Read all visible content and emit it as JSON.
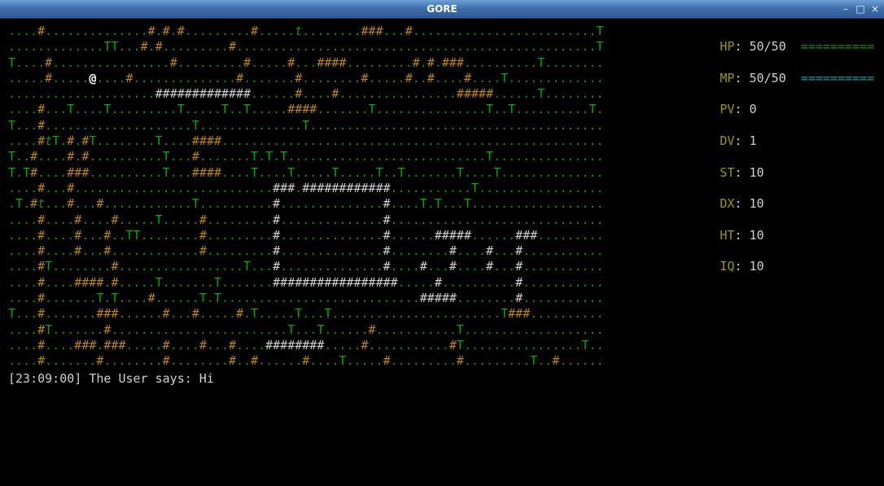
{
  "window": {
    "title": "GORE",
    "minimize_icon": "minimize-icon",
    "maximize_icon": "maximize-icon",
    "close_icon": "close-icon"
  },
  "stats": {
    "hp_label": "HP",
    "hp_value": "50/50",
    "hp_bar": "==========",
    "mp_label": "MP",
    "mp_value": "50/50",
    "mp_bar": "==========",
    "pv_label": "PV",
    "pv_value": "0",
    "dv_label": "DV",
    "dv_value": "1",
    "st_label": "ST",
    "st_value": "10",
    "dx_label": "DX",
    "dx_value": "10",
    "ht_label": "HT",
    "ht_value": "10",
    "iq_label": "IQ",
    "iq_value": "10"
  },
  "log": {
    "timestamp": "[23:09:00]",
    "text": "The User says: Hi"
  },
  "map": {
    "legend": {
      ".": "floor",
      "#": "wall",
      "T": "tree",
      "t": "creature",
      "@": "player"
    },
    "rows": [
      "....#..............#.#.#.........#.....t........###...#.........................T",
      ".............TT...#.#.........#.................................................T",
      "T....#................#.........#.....#...####.........#.#.###..........T........",
      ".....#.....@....#..............#.......#........#.....#..#....#....T.............",
      "....................#############......#....#................#####......T........",
      "....#...T....T.........T.....T..T.....####.......T...............T..T..........T.",
      "T...#....................T..............T........................................",
      "....#tT.#.#T........T....####....................................................",
      "T..#....#.#..........T...#.......T.T.T...........................T...............",
      "T.T#....###..........T...####....T....T.....T.....T..T.......T....T..............",
      "....#...#...........................###.############...........T.................",
      ".T.#t...#...#............T..........#..............#....T.T...T..................",
      "....#....#....#.....T.....#.........#..............#.............................",
      "....#....#...#..TT........#.........#..............#......#####......###.........",
      "....#....#...#............#.........#..............#........#....#...#...........",
      "....#T........#.................T...#..............#....#...#....#...#...........",
      "....#....####.#.....T.......T.......#################.....#..........#...........",
      "....#.......T.T....#......T.T...........................#####........#...........",
      "T...#.......###......#...#.....#.T.....T...T.......................T###..........",
      "....#T.......#........................T...T......#...........T...................",
      "....#....###.###.....#....#...#....########.....#...........#T................T..",
      "....#.......#........#........#..#......#....T.....#.........#.........T..#......"
    ],
    "player": "@"
  }
}
